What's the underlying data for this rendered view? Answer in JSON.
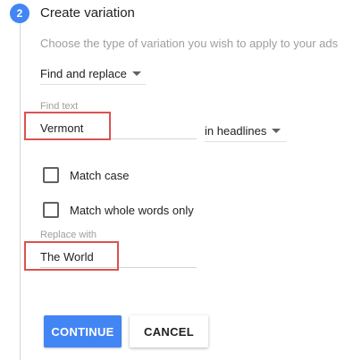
{
  "step": {
    "number": "2",
    "title": "Create variation",
    "subtitle": "Choose the type of variation you wish to apply to your ads"
  },
  "variation_type": {
    "selected": "Find and replace"
  },
  "find": {
    "label": "Find text",
    "value": "Vermont",
    "scope": "in headlines"
  },
  "options": {
    "match_case": {
      "label": "Match case",
      "checked": false
    },
    "match_whole_words": {
      "label": "Match whole words only",
      "checked": false
    }
  },
  "replace": {
    "label": "Replace with",
    "value": "The World"
  },
  "actions": {
    "continue_label": "CONTINUE",
    "cancel_label": "CANCEL"
  },
  "colors": {
    "accent": "#4285f4",
    "highlight": "#d9534f"
  }
}
